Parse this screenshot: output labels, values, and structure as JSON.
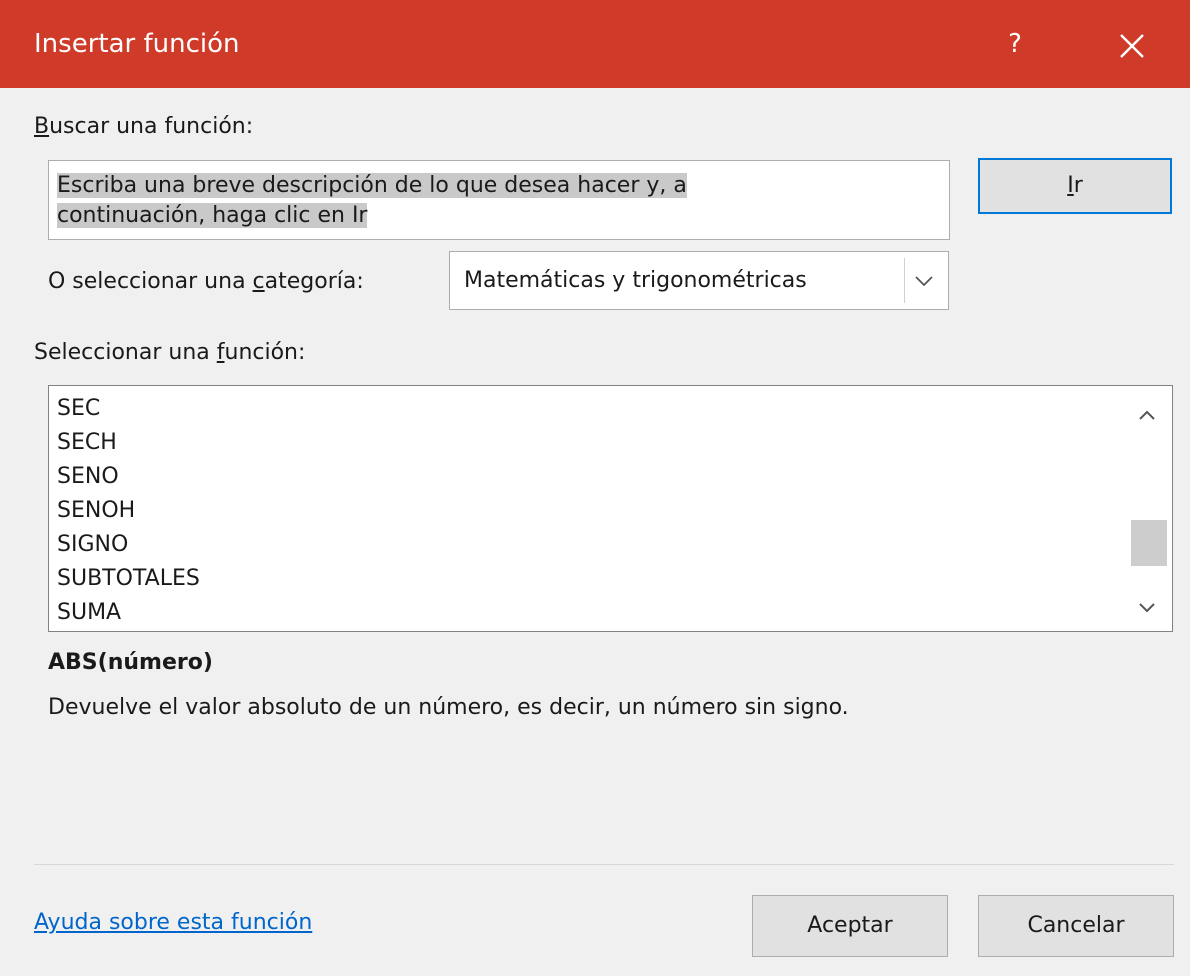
{
  "dialog": {
    "title": "Insertar función",
    "help_glyph": "?",
    "close_glyph": "×"
  },
  "search": {
    "label_access": "B",
    "label_rest": "uscar una función:",
    "placeholder_line1": "Escriba una breve descripción de lo que desea hacer y, a",
    "placeholder_line2": "continuación, haga clic en Ir",
    "go_access": "I",
    "go_rest": "r"
  },
  "category": {
    "label_pre": "O seleccionar una ",
    "label_access": "c",
    "label_post": "ategoría:",
    "selected": "Matemáticas y trigonométricas"
  },
  "functions": {
    "label_pre": "Seleccionar una ",
    "label_access": "f",
    "label_post": "unción:",
    "items": [
      "SEC",
      "SECH",
      "SENO",
      "SENOH",
      "SIGNO",
      "SUBTOTALES",
      "SUMA"
    ],
    "scroll_position": 0.58
  },
  "details": {
    "signature": "ABS(número)",
    "description": "Devuelve el valor absoluto de un número, es decir, un número sin signo."
  },
  "footer": {
    "help_link": "Ayuda sobre esta función",
    "ok": "Aceptar",
    "cancel": "Cancelar"
  },
  "colors": {
    "titlebar": "#cf3a29",
    "focus_border": "#0078d7",
    "link": "#0066cc"
  },
  "icons": {
    "close": "close-icon",
    "dropdown": "chevron-down-icon",
    "scroll_up": "chevron-up-icon",
    "scroll_down": "chevron-down-icon"
  }
}
